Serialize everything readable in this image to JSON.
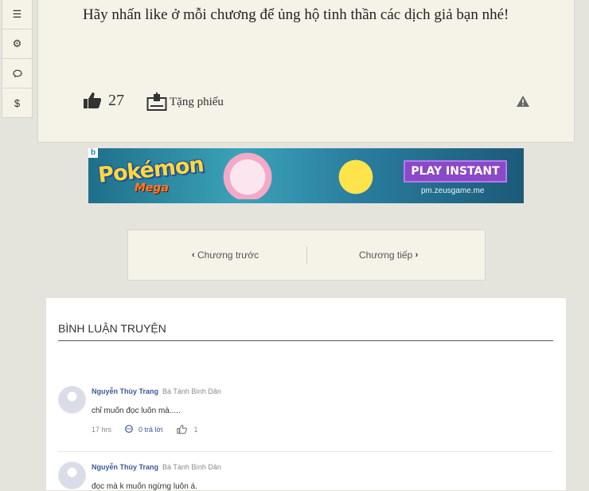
{
  "toolbar": {
    "items": [
      {
        "icon": "list-icon",
        "glyph": "☰"
      },
      {
        "icon": "gear-icon",
        "glyph": "⚙"
      },
      {
        "icon": "comment-icon",
        "glyph": "💬"
      },
      {
        "icon": "dollar-icon",
        "glyph": "$"
      }
    ]
  },
  "chapter": {
    "note": "Hãy nhấn like ở mỗi chương để ủng hộ tinh thần các dịch giả bạn nhé!",
    "like_count": "27",
    "vote_label": "Tặng phiếu"
  },
  "banner": {
    "logo": "Pokémon",
    "sub": "Mega",
    "cta": "PLAY INSTANT",
    "url": "pm.zeusgame.me"
  },
  "nav": {
    "prev_label": "Chương trước",
    "next_label": "Chương tiếp"
  },
  "comments": {
    "title": "BÌNH LUẬN TRUYỆN",
    "items": [
      {
        "name": "Nguyễn Thùy Trang",
        "rank": "Bá Tánh Bình Dân",
        "text": "chỉ muốn đọc luôn mà.....",
        "time": "17 hrs",
        "replies": "0 trả lời",
        "likes": "1"
      },
      {
        "name": "Nguyễn Thùy Trang",
        "rank": "Bá Tánh Bình Dân",
        "text": "đọc mà k muốn ngừng luôn á."
      }
    ]
  },
  "colors": {
    "page_bg": "#e4e3dc",
    "panel_bg": "#f5f2e8",
    "link": "#3b5998"
  }
}
